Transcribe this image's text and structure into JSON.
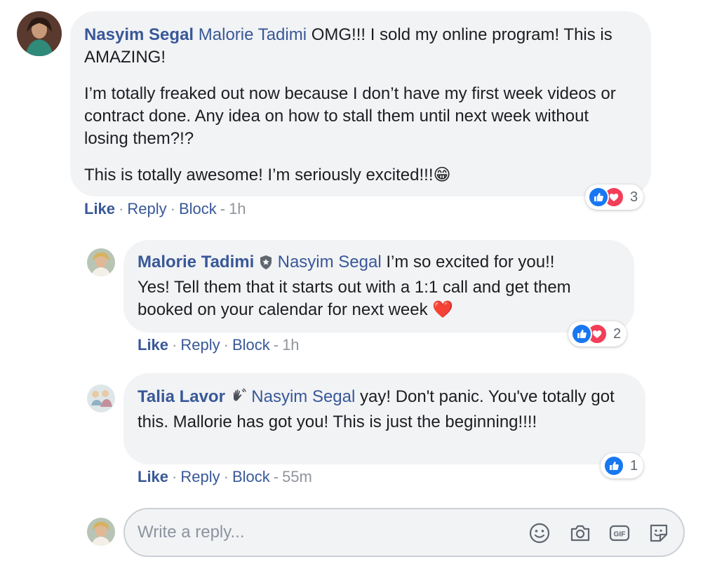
{
  "comments": [
    {
      "author": "Nasyim Segal",
      "mention": "Malorie Tadimi",
      "paragraphs": [
        "OMG!!! I sold my online program! This is AMAZING!",
        "I’m totally freaked out now because I don’t have my first week videos or contract done. Any idea on how to stall them until next week without losing them?!?",
        "This is totally awesome! I’m seriously excited!!!"
      ],
      "end_emoji": "😁",
      "reactions": {
        "types": [
          "like-icon",
          "love-icon"
        ],
        "count": "3"
      },
      "actions": {
        "like": "Like",
        "reply": "Reply",
        "block": "Block",
        "time": "1h"
      }
    },
    {
      "author": "Malorie Tadimi",
      "badge": "shield-badge-icon",
      "mention": "Nasyim Segal",
      "line1": "I’m so excited for you!!",
      "line2": "Yes! Tell them that it starts out with a 1:1 call and get them booked on your calendar for next week",
      "end_emoji": "❤️",
      "reactions": {
        "types": [
          "like-icon",
          "love-icon"
        ],
        "count": "2"
      },
      "actions": {
        "like": "Like",
        "reply": "Reply",
        "block": "Block",
        "time": "1h"
      }
    },
    {
      "author": "Talia Lavor",
      "badge": "waving-hand-badge-icon",
      "mention": "Nasyim Segal",
      "text": "yay! Don't panic. You've totally got this. Mallorie has got you! This is just the beginning!!!!",
      "reactions": {
        "types": [
          "like-icon"
        ],
        "count": "1"
      },
      "actions": {
        "like": "Like",
        "reply": "Reply",
        "block": "Block",
        "time": "55m"
      }
    }
  ],
  "reply_box": {
    "placeholder": "Write a reply...",
    "icons": [
      "emoji-icon",
      "camera-icon",
      "gif-icon",
      "sticker-icon"
    ]
  },
  "colors": {
    "link": "#385898",
    "bubble": "#f2f3f5",
    "like": "#1877f2",
    "love": "#f33e58",
    "meta": "#90949c"
  }
}
